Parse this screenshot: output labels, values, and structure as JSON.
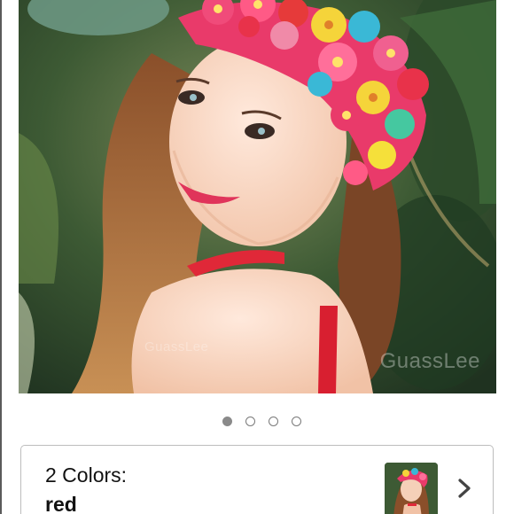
{
  "product_image": {
    "alt": "Woman wearing a floral petal swim cap",
    "watermark": "GuassLee",
    "watermark_small": "GuassLee"
  },
  "carousel": {
    "count": 4,
    "active_index": 0
  },
  "variation": {
    "label": "2 Colors:",
    "selected_value": "red",
    "chevron_icon": "chevron-right-icon"
  },
  "colors": {
    "accent_red": "#e02838",
    "border": "#bdbdbd",
    "dot_active": "#8a8a8a"
  }
}
